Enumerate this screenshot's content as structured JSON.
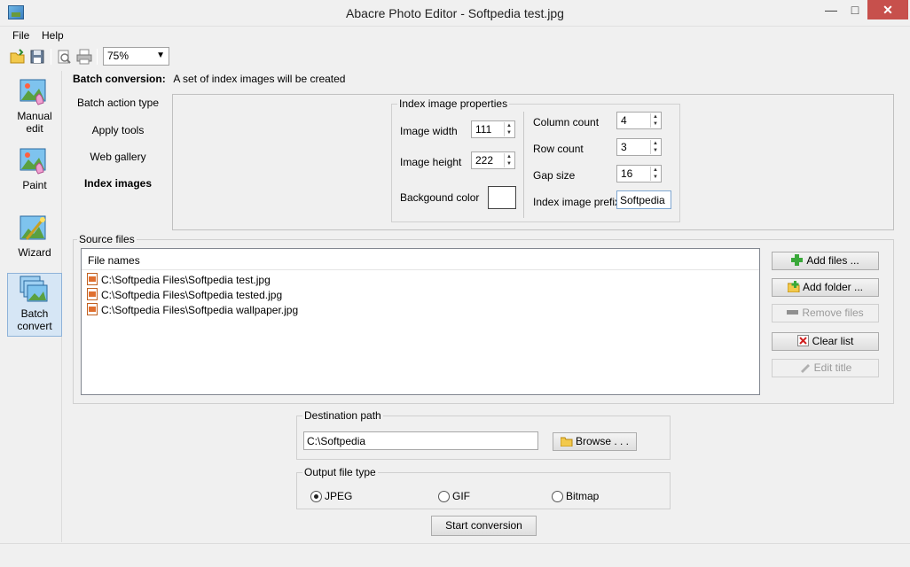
{
  "window": {
    "title": "Abacre Photo Editor - Softpedia test.jpg"
  },
  "menu": [
    {
      "label": "File"
    },
    {
      "label": "Help"
    }
  ],
  "toolbar": {
    "zoom": "75%"
  },
  "leftnav": [
    {
      "label_1": "Manual",
      "label_2": "edit"
    },
    {
      "label_1": "Paint",
      "label_2": ""
    },
    {
      "label_1": "Wizard",
      "label_2": ""
    },
    {
      "label_1": "Batch",
      "label_2": "convert"
    }
  ],
  "header": {
    "title": "Batch conversion:",
    "description": "A set of index images will be created"
  },
  "actions": [
    {
      "label": "Batch action type"
    },
    {
      "label": "Apply tools"
    },
    {
      "label": "Web gallery"
    },
    {
      "label": "Index images"
    }
  ],
  "index_props": {
    "legend": "Index image properties",
    "image_width_label": "Image width",
    "image_width": "111",
    "image_height_label": "Image height",
    "image_height": "222",
    "background_color_label": "Backgound color",
    "background_color": "#ffffff",
    "column_count_label": "Column count",
    "column_count": "4",
    "row_count_label": "Row count",
    "row_count": "3",
    "gap_size_label": "Gap size",
    "gap_size": "16",
    "prefix_label": "Index image prefix",
    "prefix": "Softpedia"
  },
  "source": {
    "legend": "Source files",
    "column": "File names",
    "files": [
      "C:\\Softpedia Files\\Softpedia test.jpg",
      "C:\\Softpedia Files\\Softpedia tested.jpg",
      "C:\\Softpedia Files\\Softpedia wallpaper.jpg"
    ],
    "buttons": {
      "add_files": "Add files ...",
      "add_folder": "Add folder ...",
      "remove_files": "Remove files",
      "clear_list": "Clear list",
      "edit_title": "Edit title"
    }
  },
  "destination": {
    "legend": "Destination path",
    "path": "C:\\Softpedia",
    "browse": "Browse . . ."
  },
  "output": {
    "legend": "Output file type",
    "options": [
      {
        "label": "JPEG",
        "selected": true
      },
      {
        "label": "GIF",
        "selected": false
      },
      {
        "label": "Bitmap",
        "selected": false
      }
    ]
  },
  "start_button": "Start conversion",
  "colors": {
    "accent": "#2a5e8f",
    "close": "#c7504c",
    "selected_nav": "#d6e6f5"
  }
}
